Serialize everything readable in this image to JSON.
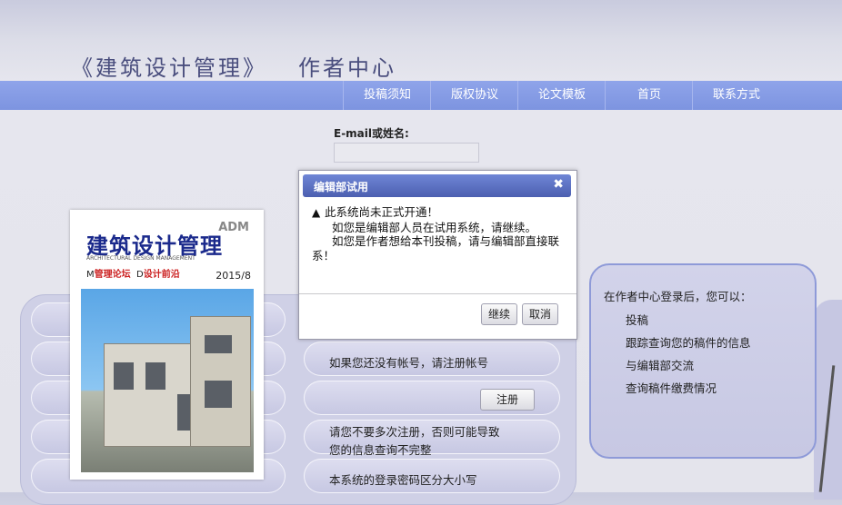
{
  "header": {
    "journal_title": "《建筑设计管理》",
    "section_title": "作者中心"
  },
  "nav": {
    "items": [
      {
        "label": "投稿须知"
      },
      {
        "label": "版权协议"
      },
      {
        "label": "论文模板"
      },
      {
        "label": "首页"
      },
      {
        "label": "联系方式"
      }
    ]
  },
  "login": {
    "email_label": "E-mail或姓名:",
    "email_value": ""
  },
  "cover": {
    "title": "建筑设计管理",
    "adm": "ADM",
    "subtitle": "ARCHITECTURAL DESIGN MANAGEMENT",
    "tag1_letter": "M",
    "tag1_text": "管理论坛",
    "tag2_letter": "D",
    "tag2_text": "设计前沿",
    "issue": "2015/8"
  },
  "main": {
    "register_hint": "如果您还没有帐号，请注册帐号",
    "register_button": "注册",
    "warning_line1": "请您不要多次注册，否则可能导致",
    "warning_line2": "您的信息查询不完整",
    "case_hint": "本系统的登录密码区分大小写"
  },
  "info": {
    "title": "在作者中心登录后，您可以：",
    "items": [
      "投稿",
      "跟踪查询您的稿件的信息",
      "与编辑部交流",
      "查询稿件缴费情况"
    ]
  },
  "dialog": {
    "title": "编辑部试用",
    "close_icon": "close-icon",
    "line1": "此系统尚未正式开通！",
    "line2": "如您是编辑部人员在试用系统，请继续。",
    "line3": "如您是作者想给本刊投稿，请与编辑部直接联系！",
    "continue_label": "继续",
    "cancel_label": "取消"
  }
}
